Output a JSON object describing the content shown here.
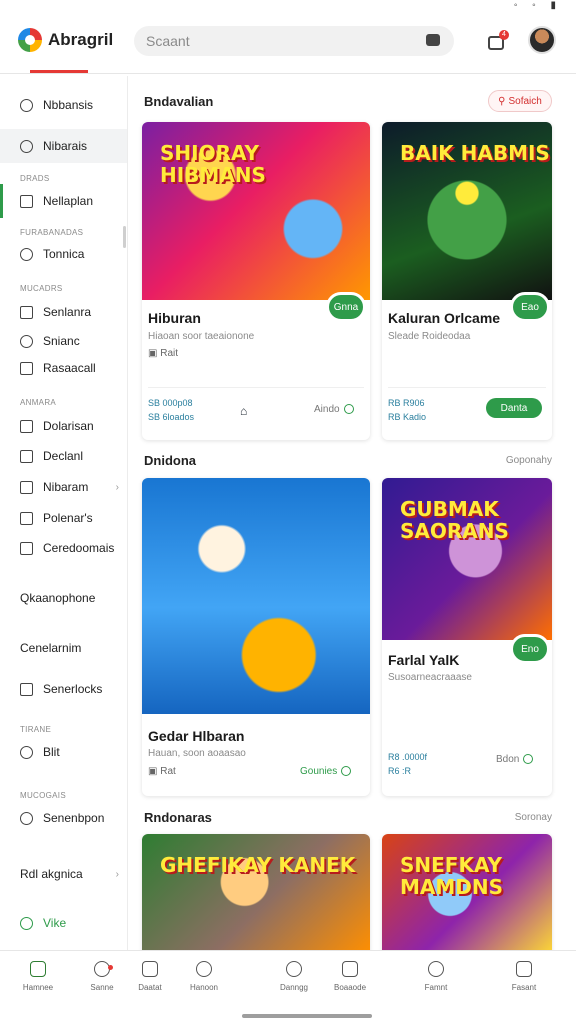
{
  "header": {
    "logo_text": "Abragril",
    "search_placeholder": "Scaant",
    "cart_count": "4"
  },
  "sidebar": {
    "items_top": [
      {
        "label": "Nbbansis",
        "icon": "user-icon"
      },
      {
        "label": "Nibarais",
        "icon": "search-icon"
      }
    ],
    "head1": "DRADS",
    "item_a": "Nellaplan",
    "head2": "FURABANADAS",
    "item_b": "Tonnica",
    "head3": "MUCADRS",
    "items_c": [
      "Senlanra",
      "Snianc",
      "Rasaacall"
    ],
    "head4": "ANMARA",
    "items_d": [
      "Dolarisan",
      "Declanl",
      "Nibaram",
      "Polenar's",
      "Ceredoomais"
    ],
    "item_e": "Qkaanophone",
    "item_f": "Cenelarnim",
    "item_g": "Senerlocks",
    "head5": "TIRANE",
    "item_h": "Blit",
    "head6": "MUCOGAIS",
    "item_i": "Senenbpon",
    "item_j": "Rdl akgnica",
    "item_k": "Vike"
  },
  "main": {
    "section1": {
      "title": "Bndavalian",
      "button": "Sofaich"
    },
    "section2": {
      "title": "Dnidona",
      "link": "Goponahy"
    },
    "section3": {
      "title": "Rndonaras",
      "link": "Soronay"
    },
    "cards": [
      {
        "art_caption": "SHIORAY HIBMANS",
        "title": "Hiburan",
        "subtitle": "Hiaoan soor taeaionone",
        "meta": "Rait",
        "price1": "SB 000p08",
        "price2": "SB 6loados",
        "play": "Gnna",
        "status": "Aindo"
      },
      {
        "art_caption": "BAIK HABMIS",
        "title": "Kaluran Orlcame",
        "subtitle": "Sleade Roideodaa",
        "price1": "RB R906",
        "price2": "RB Kadio",
        "play": "Eao",
        "action": "Danta"
      },
      {
        "art_caption": "",
        "title": "Gedar Hlbaran",
        "subtitle": "Hauan, soon aoaasao",
        "meta": "Rat",
        "action": "Gounies"
      },
      {
        "art_caption": "GUBMAK SAORANS",
        "title": "Farlal YalK",
        "subtitle": "Susoarneacraaase",
        "price1": "R8 .0000f",
        "price2": "R6 :R",
        "play": "Eno",
        "status": "Bdon"
      },
      {
        "art_caption": "GHEFIKAY KANEK",
        "title": ""
      },
      {
        "art_caption": "SNEFKAY MAMDNS",
        "title": ""
      }
    ]
  },
  "bottom_nav": [
    {
      "label": "Hamnee",
      "icon": "home-icon"
    },
    {
      "label": "Sanne",
      "icon": "gift-icon"
    },
    {
      "label": "Daatat",
      "icon": "basket-icon"
    },
    {
      "label": "Hanoon",
      "icon": "search-icon"
    },
    {
      "label": "Danngg",
      "icon": "chat-icon"
    },
    {
      "label": "Boaaode",
      "icon": "image-icon"
    },
    {
      "label": "Famnt",
      "icon": "globe-icon"
    },
    {
      "label": "Fasant",
      "icon": "doc-icon"
    }
  ]
}
